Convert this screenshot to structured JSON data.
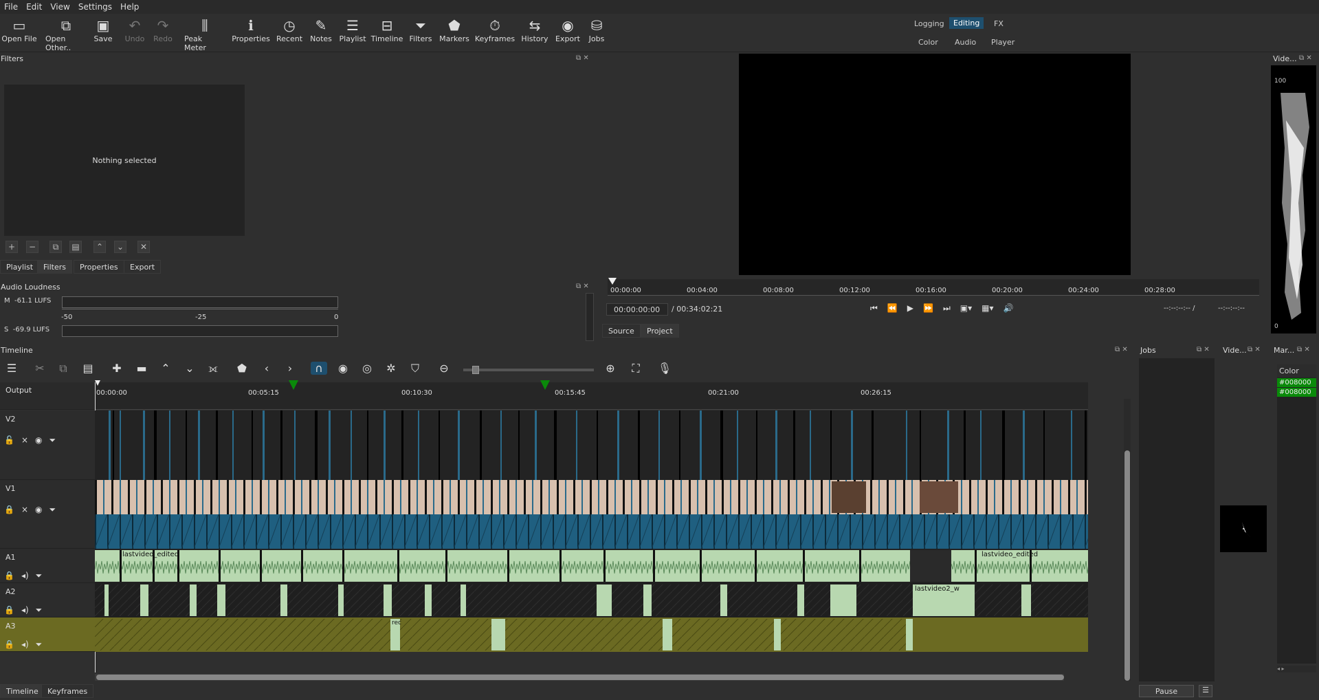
{
  "menu": [
    "File",
    "Edit",
    "View",
    "Settings",
    "Help"
  ],
  "toolbar": [
    {
      "label": "Open File",
      "icon": "folder-open-icon",
      "glyph": "▭",
      "disabled": false
    },
    {
      "label": "Open Other..",
      "icon": "open-other-icon",
      "glyph": "⧉",
      "disabled": false
    },
    {
      "label": "Save",
      "icon": "save-icon",
      "glyph": "▣",
      "disabled": false
    },
    {
      "label": "Undo",
      "icon": "undo-icon",
      "glyph": "↶",
      "disabled": true
    },
    {
      "label": "Redo",
      "icon": "redo-icon",
      "glyph": "↷",
      "disabled": true
    },
    {
      "label": "Peak Meter",
      "icon": "peak-meter-icon",
      "glyph": "⫼",
      "disabled": false
    },
    {
      "label": "Properties",
      "icon": "info-icon",
      "glyph": "ℹ",
      "disabled": false
    },
    {
      "label": "Recent",
      "icon": "clock-icon",
      "glyph": "◷",
      "disabled": false
    },
    {
      "label": "Notes",
      "icon": "notes-icon",
      "glyph": "✎",
      "disabled": false
    },
    {
      "label": "Playlist",
      "icon": "list-icon",
      "glyph": "☰",
      "disabled": false
    },
    {
      "label": "Timeline",
      "icon": "timeline-icon",
      "glyph": "⊟",
      "disabled": false
    },
    {
      "label": "Filters",
      "icon": "filter-icon",
      "glyph": "⏷",
      "disabled": false
    },
    {
      "label": "Markers",
      "icon": "marker-icon",
      "glyph": "⬟",
      "disabled": false
    },
    {
      "label": "Keyframes",
      "icon": "stopwatch-icon",
      "glyph": "⏱",
      "disabled": false
    },
    {
      "label": "History",
      "icon": "history-icon",
      "glyph": "⇆",
      "disabled": false
    },
    {
      "label": "Export",
      "icon": "export-icon",
      "glyph": "◉",
      "disabled": false
    },
    {
      "label": "Jobs",
      "icon": "jobs-icon",
      "glyph": "⛁",
      "disabled": false
    }
  ],
  "workspaces": {
    "row1": [
      "Logging",
      "Editing",
      "FX"
    ],
    "row2": [
      "Color",
      "Audio",
      "Player"
    ],
    "active": "Editing"
  },
  "filters": {
    "title": "Filters",
    "empty": "Nothing selected"
  },
  "left_tabs": [
    "Playlist",
    "Filters",
    "Properties",
    "Export"
  ],
  "audio_loudness": {
    "title": "Audio Loudness",
    "m_label": "M",
    "m_value": "-61.1",
    "s_label": "S",
    "s_value": "-69.9",
    "unit": "LUFS",
    "scale": [
      "-50",
      "-25",
      "0"
    ]
  },
  "player": {
    "ruler": [
      "00:00:00",
      "00:04:00",
      "00:08:00",
      "00:12:00",
      "00:16:00",
      "00:20:00",
      "00:24:00",
      "00:28:00"
    ],
    "timecode": "00:00:00:00",
    "duration": "/ 00:34:02:21",
    "tabs": [
      "Source",
      "Project"
    ],
    "in_point": "--:--:--:-- /",
    "out_point": "--:--:--:--"
  },
  "scopes": {
    "video_title": "Vide...",
    "scale_top": "100",
    "scale_bottom": "0"
  },
  "timeline": {
    "title": "Timeline",
    "output": "Output",
    "ruler": [
      "00:00:00",
      "00:05:15",
      "00:10:30",
      "00:15:45",
      "00:21:00",
      "00:26:15"
    ],
    "tracks": [
      {
        "name": "V2",
        "kind": "video"
      },
      {
        "name": "V1",
        "kind": "video"
      },
      {
        "name": "A1",
        "kind": "audio"
      },
      {
        "name": "A2",
        "kind": "audio"
      },
      {
        "name": "A3",
        "kind": "audio"
      }
    ],
    "clip_labels": {
      "a1": "lastvideo_edited",
      "a2": "lastvideo2_w",
      "a3": "rec"
    }
  },
  "bottom_tabs": [
    "Timeline",
    "Keyframes"
  ],
  "jobs": {
    "title": "Jobs",
    "pause": "Pause"
  },
  "video_small": {
    "title": "Vide..."
  },
  "markers": {
    "title": "Mar...",
    "header": "Color",
    "items": [
      "#008000",
      "#008000"
    ]
  },
  "colors": {
    "accent": "#1e4f6e",
    "marker": "#008000",
    "a3": "#6b6a22",
    "clip": "#b8d8b0"
  }
}
